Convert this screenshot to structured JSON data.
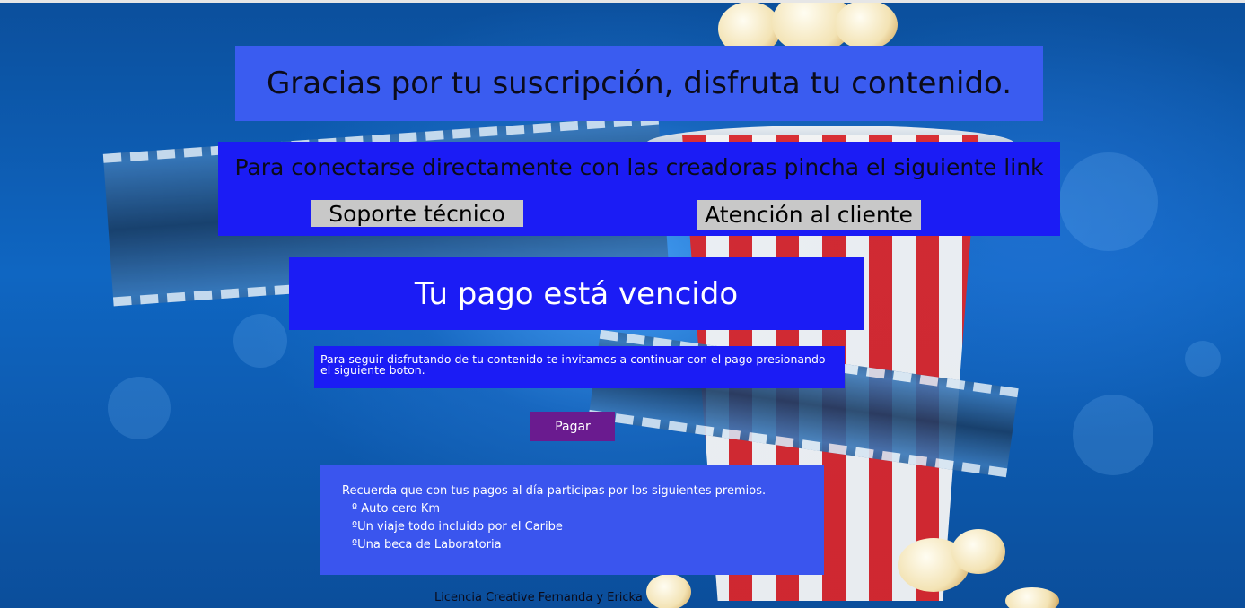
{
  "header": {
    "title": "Gracias por tu suscripción, disfruta tu contenido."
  },
  "contact": {
    "text": "Para conectarse directamente con las creadoras pincha el siguiente link",
    "support_label": "Soporte técnico",
    "customer_label": "Atención al cliente"
  },
  "payment": {
    "status_title": "Tu pago está vencido",
    "message": "Para seguir disfrutando de tu contenido te invitamos a continuar con el pago presionando el siguiente boton.",
    "pay_label": "Pagar"
  },
  "prizes": {
    "intro": "Recuerda que con tus pagos al día participas por los siguientes premios.",
    "items": [
      "º Auto cero Km",
      "ºUn viaje todo incluido por el Caribe",
      "ºUna beca de Laboratoria"
    ]
  },
  "footer": {
    "license": "Licencia Creative Fernanda y Ericka"
  },
  "colors": {
    "title_panel": "#3a5cf0",
    "panel_blue": "#1b1cf5",
    "pay_button": "#6a1b8f",
    "link_button": "#c8c8c8"
  },
  "icons": {
    "background": "cinema-popcorn-film-illustration"
  }
}
